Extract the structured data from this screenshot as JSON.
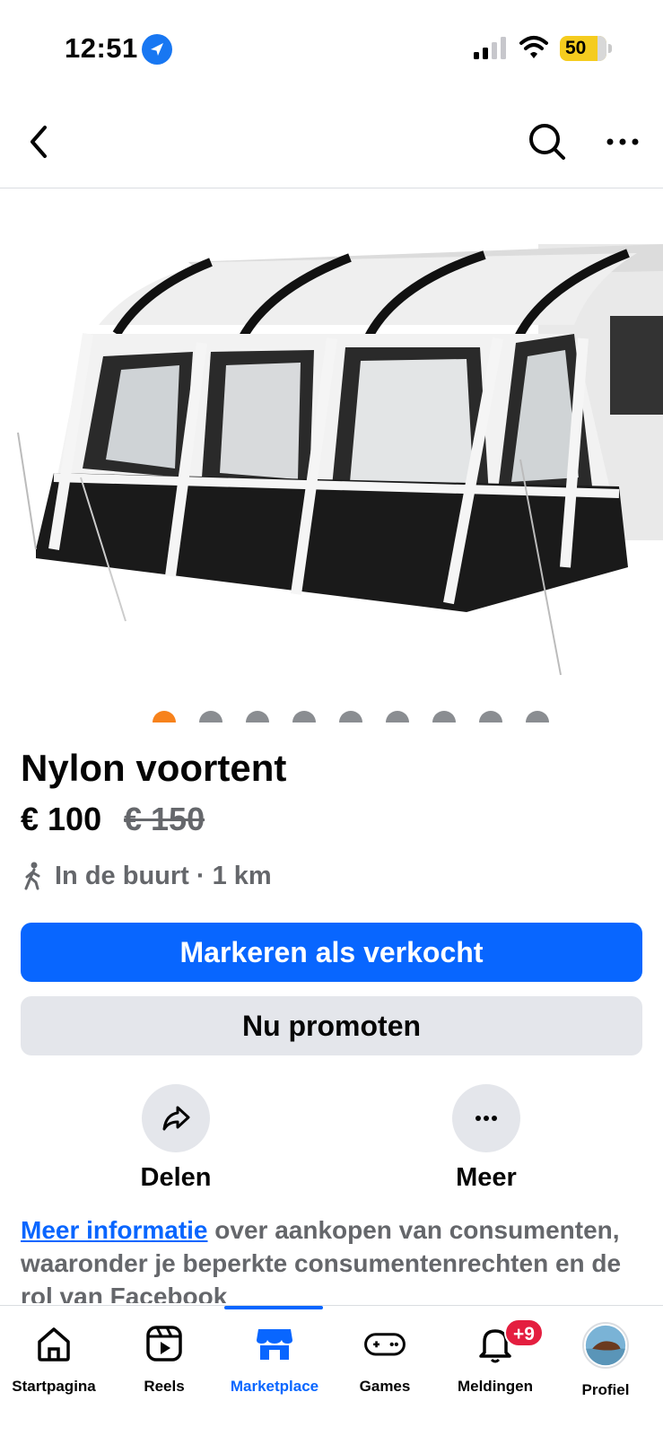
{
  "status_bar": {
    "time": "12:51",
    "battery": "50"
  },
  "top_nav": {
    "back_icon": "chevron-left-icon",
    "search_icon": "search-icon",
    "more_icon": "more-horizontal-icon"
  },
  "carousel": {
    "total_images": 9,
    "active_index": 0,
    "active_color": "#f7821b"
  },
  "product": {
    "title": "Nylon voortent",
    "price": "€ 100",
    "old_price": "€ 150",
    "location": "In de buurt · 1 km"
  },
  "buttons": {
    "primary": "Markeren als verkocht",
    "secondary": "Nu promoten"
  },
  "actions": {
    "share": "Delen",
    "more": "Meer"
  },
  "info": {
    "link": "Meer informatie",
    "text": " over aankopen van consumenten, waaronder je beperkte consumentenrechten en de rol van Facebook"
  },
  "tab_bar": {
    "tabs": [
      {
        "label": "Startpagina",
        "icon": "home-icon"
      },
      {
        "label": "Reels",
        "icon": "reels-icon"
      },
      {
        "label": "Marketplace",
        "icon": "marketplace-icon"
      },
      {
        "label": "Games",
        "icon": "gamepad-icon"
      },
      {
        "label": "Meldingen",
        "icon": "bell-icon"
      },
      {
        "label": "Profiel",
        "icon": "avatar"
      }
    ],
    "active": "Marketplace",
    "notification_badge": "+9"
  },
  "colors": {
    "accent": "#0866ff",
    "secondary_bg": "#e4e6eb",
    "muted_text": "#65676b",
    "badge": "#e41e3f"
  }
}
